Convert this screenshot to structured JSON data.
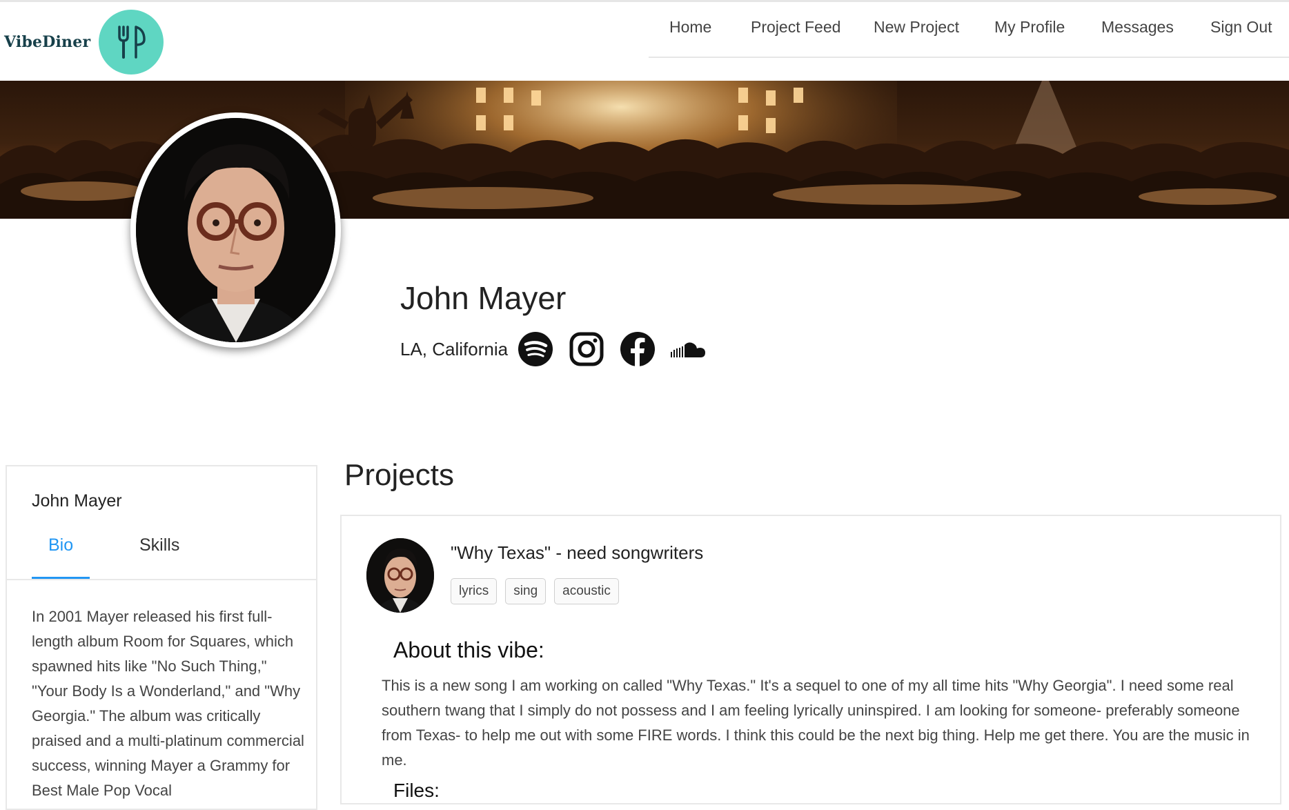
{
  "header": {
    "brand_name": "VibeDiner",
    "brand_icon": "fork-knife-icon",
    "nav": [
      "Home",
      "Project Feed",
      "New Project",
      "My Profile",
      "Messages",
      "Sign Out"
    ]
  },
  "profile": {
    "name": "John Mayer",
    "location": "LA, California",
    "social": [
      "spotify-icon",
      "instagram-icon",
      "facebook-icon",
      "soundcloud-icon"
    ]
  },
  "sidebar": {
    "name": "John Mayer",
    "tabs": [
      "Bio",
      "Skills"
    ],
    "active_tab": "Bio",
    "bio": "In 2001 Mayer released his first full-length album Room for Squares, which spawned hits like \"No Such Thing,\" \"Your Body Is a Wonderland,\" and \"Why Georgia.\" The album was critically praised and a multi-platinum commercial success, winning Mayer a Grammy for Best Male Pop Vocal"
  },
  "projects": {
    "heading": "Projects",
    "items": [
      {
        "title": "\"Why Texas\" - need songwriters",
        "tags": [
          "lyrics",
          "sing",
          "acoustic"
        ],
        "about_heading": "About this vibe:",
        "about": "This is a new song I am working on called \"Why Texas.\" It's a sequel to one of my all time hits \"Why Georgia\". I need some real southern twang that I simply do not possess and I am feeling lyrically uninspired. I am looking for someone- preferably someone from Texas- to help me out with some FIRE words. I think this could be the next big thing. Help me get there. You are the music in me.",
        "files_heading": "Files:"
      }
    ]
  },
  "colors": {
    "accent": "#2196f3",
    "brand_teal": "#5fd6c2",
    "brand_text": "#17404a"
  }
}
